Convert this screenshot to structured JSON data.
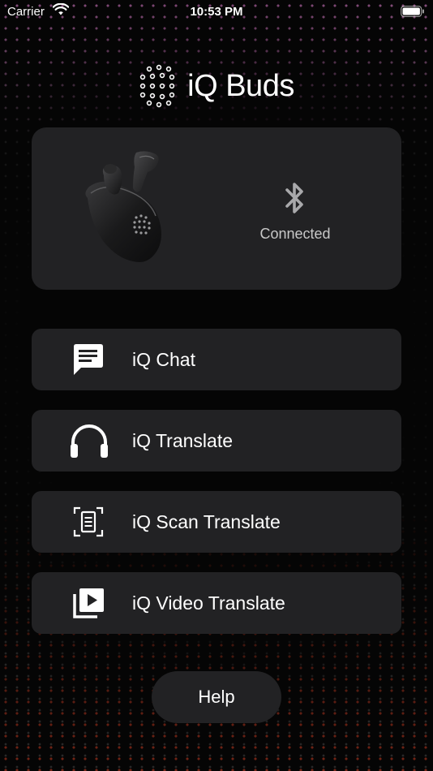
{
  "status_bar": {
    "carrier": "Carrier",
    "time": "10:53 PM",
    "wifi_icon": "wifi-icon",
    "battery_icon": "battery-icon"
  },
  "header": {
    "logo_text": "iQ Buds",
    "logo_icon": "dot-grid-logo-icon"
  },
  "device": {
    "image": "earbuds-case-image",
    "bluetooth_icon": "bluetooth-icon",
    "status": "Connected"
  },
  "features": [
    {
      "label": "iQ Chat",
      "icon": "chat-bubble-icon"
    },
    {
      "label": "iQ Translate",
      "icon": "headphones-icon"
    },
    {
      "label": "iQ Scan Translate",
      "icon": "document-scan-icon"
    },
    {
      "label": "iQ Video Translate",
      "icon": "video-library-icon"
    }
  ],
  "help": {
    "label": "Help"
  },
  "colors": {
    "background": "#050505",
    "card": "#222224",
    "accent_top": "#e678d2",
    "accent_bottom": "#eb4628"
  }
}
